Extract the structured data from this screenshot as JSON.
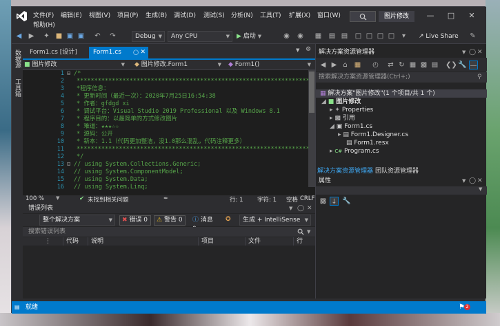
{
  "menu": [
    "文件(F)",
    "编辑(E)",
    "视图(V)",
    "项目(P)",
    "生成(B)",
    "调试(D)",
    "测试(S)",
    "分析(N)",
    "工具(T)",
    "扩展(X)",
    "窗口(W)",
    "帮助(H)"
  ],
  "title": "图片修改",
  "toolbar": {
    "config": "Debug",
    "platform": "Any CPU",
    "start": "启动",
    "liveshare": "Live Share"
  },
  "sidetabs": [
    "数据源",
    "工具箱"
  ],
  "doctabs": [
    {
      "label": "Form1.cs [设计]"
    },
    {
      "label": "Form1.cs"
    }
  ],
  "navbar": {
    "project": "图片修改",
    "class": "图片修改.Form1",
    "member": "Form1()"
  },
  "code_lines": [
    {
      "n": "1",
      "t": "/*"
    },
    {
      "n": "2",
      "t": " *********************************************************************"
    },
    {
      "n": "3",
      "t": " *程序信息："
    },
    {
      "n": "4",
      "t": " *    更新时间（最近一次）：2020年7月25日16:54:38"
    },
    {
      "n": "5",
      "t": " *    作者：gfdgd xi"
    },
    {
      "n": "6",
      "t": " *    调试平台：Visual Studio 2019 Professional 以及 Windows 8.1"
    },
    {
      "n": "7",
      "t": " *    程序目的：以最简单的方式修改图片"
    },
    {
      "n": "8",
      "t": " *    难道：★★★☆☆"
    },
    {
      "n": "9",
      "t": " *    源码：公开"
    },
    {
      "n": "10",
      "t": " *    新本：1.1（代码更加整洁，没1.0那么混乱，代码注释更多）"
    },
    {
      "n": "11",
      "t": " *********************************************************************"
    },
    {
      "n": "12",
      "t": " */"
    },
    {
      "n": "13",
      "t": "// using System.Collections.Generic;"
    },
    {
      "n": "14",
      "t": "// using System.ComponentModel;"
    },
    {
      "n": "15",
      "t": "// using System.Data;"
    },
    {
      "n": "16",
      "t": "// using System.Linq;"
    }
  ],
  "editor_status": {
    "zoom": "100 %",
    "issues": "未找到相关问题",
    "line": "行: 1",
    "char": "字符: 1",
    "mode": "空格",
    "eol": "CRLF"
  },
  "errors": {
    "title": "错误列表",
    "scope": "整个解决方案",
    "errors": "错误 0",
    "warnings": "警告 0",
    "messages": "消息 0",
    "build": "生成 + IntelliSense",
    "search_placeholder": "搜索错误列表",
    "columns": [
      "代码",
      "说明",
      "项目",
      "文件",
      "行"
    ]
  },
  "solution": {
    "title": "解决方案资源管理器",
    "search_placeholder": "搜索解决方案资源管理器(Ctrl+;)",
    "nodes": [
      {
        "label": "解决方案\"图片修改\"(1 个项目/共 1 个)"
      },
      {
        "label": "图片修改"
      },
      {
        "label": "Properties"
      },
      {
        "label": "引用"
      },
      {
        "label": "Form1.cs"
      },
      {
        "label": "Form1.Designer.cs"
      },
      {
        "label": "Form1.resx"
      },
      {
        "label": "Program.cs"
      }
    ],
    "tabs": [
      "解决方案资源管理器",
      "团队资源管理器"
    ]
  },
  "properties": {
    "title": "属性"
  },
  "status": {
    "text": "就绪",
    "notifications": "2"
  },
  "colors": {
    "accent": "#007acc",
    "comment": "#57a64a",
    "linenumber": "#2b91af"
  }
}
